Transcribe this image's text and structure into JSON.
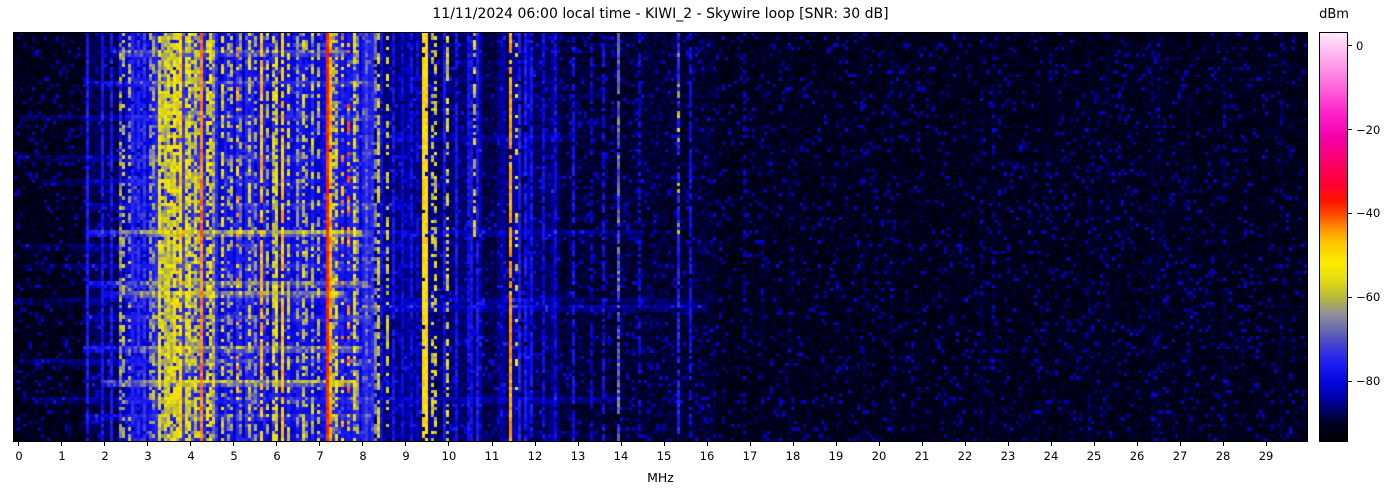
{
  "chart_data": {
    "type": "heatmap",
    "title": "11/11/2024 06:00 local time - KIWI_2 - Skywire loop [SNR: 30 dB]",
    "xlabel": "MHz",
    "colorbar_label": "dBm",
    "x_range_mhz": [
      -0.116,
      29.953
    ],
    "x_ticks_mhz": [
      0,
      1,
      2,
      3,
      4,
      5,
      6,
      7,
      8,
      9,
      10,
      11,
      12,
      13,
      14,
      15,
      16,
      17,
      18,
      19,
      20,
      21,
      22,
      23,
      24,
      25,
      26,
      27,
      28,
      29
    ],
    "colorbar_ticks_dbm": [
      0,
      -20,
      -40,
      -60,
      -80
    ],
    "colorbar_tick_labels": [
      "0",
      "−20",
      "−40",
      "−60",
      "−80"
    ],
    "value_range_dbm": [
      -94.2,
      3.0
    ],
    "grid": false,
    "legend": "none",
    "freq_bins": 431,
    "time_rows": 120,
    "colormap_stops_dbm_hex": [
      [
        -94.5,
        "#000000"
      ],
      [
        -90,
        "#000022"
      ],
      [
        -87,
        "#000068"
      ],
      [
        -84,
        "#0000aa"
      ],
      [
        -80,
        "#0707e0"
      ],
      [
        -76,
        "#1c1cf4"
      ],
      [
        -72,
        "#3c3cd8"
      ],
      [
        -68,
        "#6767b2"
      ],
      [
        -64,
        "#91919b"
      ],
      [
        -60,
        "#b8b83c"
      ],
      [
        -56,
        "#e2dc12"
      ],
      [
        -52,
        "#fcec00"
      ],
      [
        -47,
        "#ffc800"
      ],
      [
        -43,
        "#ff8800"
      ],
      [
        -40,
        "#ff4400"
      ],
      [
        -37,
        "#ff1500"
      ],
      [
        -33,
        "#ff0033"
      ],
      [
        -28,
        "#fb0068"
      ],
      [
        -22,
        "#f700aa"
      ],
      [
        -16,
        "#ff22cc"
      ],
      [
        -10,
        "#ff66dd"
      ],
      [
        -4,
        "#ffa2ea"
      ],
      [
        1,
        "#ffd7f7"
      ],
      [
        3,
        "#ffeafc"
      ]
    ],
    "background_floor_dbm": [
      [
        -0.2,
        1.55,
        -91.5
      ],
      [
        1.55,
        2.3,
        -88.5
      ],
      [
        2.3,
        3.05,
        -83.5
      ],
      [
        3.05,
        4.55,
        -77.5
      ],
      [
        4.55,
        6.5,
        -80.0
      ],
      [
        6.5,
        8.25,
        -79.0
      ],
      [
        8.25,
        9.35,
        -86.5
      ],
      [
        9.35,
        10.75,
        -87.5
      ],
      [
        10.75,
        11.35,
        -89.0
      ],
      [
        11.35,
        12.6,
        -88.0
      ],
      [
        12.6,
        16.2,
        -90.0
      ],
      [
        16.2,
        30.1,
        -91.5
      ]
    ],
    "band_format": [
      "freq_mhz",
      "width_mhz",
      "level_dbm",
      "duty",
      "jitter_db",
      "row_start_frac",
      "row_end_frac"
    ],
    "signal_bands": [
      [
        1.57,
        0.06,
        -77,
        0.95,
        3,
        0,
        1
      ],
      [
        1.93,
        0.06,
        -78,
        0.95,
        3,
        0,
        1
      ],
      [
        2.12,
        0.06,
        -77,
        0.95,
        3,
        0,
        1
      ],
      [
        2.33,
        0.05,
        -62,
        0.5,
        5,
        0,
        1
      ],
      [
        2.44,
        0.05,
        -60,
        0.5,
        5,
        0,
        1
      ],
      [
        2.56,
        0.05,
        -62,
        0.45,
        5,
        0,
        1
      ],
      [
        2.65,
        0.05,
        -75,
        0.9,
        3,
        0,
        1
      ],
      [
        2.8,
        0.05,
        -74,
        0.9,
        3,
        0,
        1
      ],
      [
        2.95,
        0.05,
        -73,
        0.85,
        3,
        0,
        1
      ],
      [
        3.05,
        0.05,
        -64,
        0.5,
        5,
        0,
        1
      ],
      [
        3.15,
        0.05,
        -62,
        0.5,
        5,
        0,
        1
      ],
      [
        3.28,
        0.08,
        -55,
        0.85,
        4,
        0,
        1
      ],
      [
        3.3,
        0.2,
        -62,
        0.4,
        6,
        0,
        1
      ],
      [
        3.38,
        0.05,
        -58,
        0.6,
        5,
        0,
        1
      ],
      [
        3.45,
        0.3,
        -60,
        0.45,
        6,
        0,
        1
      ],
      [
        3.47,
        0.05,
        -56,
        0.7,
        5,
        0,
        1
      ],
      [
        3.55,
        0.05,
        -59,
        0.5,
        5,
        0,
        1
      ],
      [
        3.63,
        0.1,
        -54,
        0.8,
        5,
        0,
        1
      ],
      [
        3.72,
        0.05,
        -57,
        0.6,
        5,
        0,
        1
      ],
      [
        3.79,
        0.05,
        -49,
        0.85,
        4,
        0,
        1
      ],
      [
        3.87,
        0.05,
        -56,
        0.6,
        5,
        0,
        1
      ],
      [
        3.93,
        0.05,
        -60,
        0.5,
        5,
        0,
        1
      ],
      [
        3.98,
        0.05,
        -55,
        0.7,
        5,
        0,
        1
      ],
      [
        4.0,
        0.25,
        -61,
        0.4,
        6,
        0,
        1
      ],
      [
        4.07,
        0.05,
        -57,
        0.55,
        5,
        0,
        1
      ],
      [
        4.15,
        0.05,
        -61,
        0.5,
        5,
        0,
        1
      ],
      [
        4.26,
        0.06,
        -43,
        1.0,
        3,
        0,
        1
      ],
      [
        4.35,
        0.05,
        -56,
        0.6,
        5,
        0,
        1
      ],
      [
        4.44,
        0.05,
        -55,
        0.65,
        5,
        0,
        1
      ],
      [
        4.52,
        0.05,
        -60,
        0.5,
        5,
        0,
        1
      ],
      [
        4.62,
        0.05,
        -74,
        0.9,
        3,
        0,
        1
      ],
      [
        4.72,
        0.05,
        -57,
        0.55,
        5,
        0,
        1
      ],
      [
        4.85,
        0.05,
        -63,
        0.45,
        5,
        0,
        1
      ],
      [
        4.95,
        0.05,
        -61,
        0.5,
        5,
        0,
        1
      ],
      [
        5.06,
        0.05,
        -48,
        0.3,
        6,
        0,
        1
      ],
      [
        5.18,
        0.05,
        -64,
        0.45,
        5,
        0,
        1
      ],
      [
        5.35,
        0.05,
        -58,
        0.6,
        5,
        0,
        1
      ],
      [
        5.5,
        0.05,
        -63,
        0.5,
        5,
        0,
        1
      ],
      [
        5.67,
        0.05,
        -47,
        0.85,
        4,
        0,
        1
      ],
      [
        5.8,
        0.05,
        -60,
        0.5,
        5,
        0,
        1
      ],
      [
        5.9,
        0.05,
        -57,
        0.6,
        5,
        0,
        1
      ],
      [
        6.0,
        0.05,
        -56,
        0.7,
        5,
        0,
        1
      ],
      [
        6.14,
        0.05,
        -48,
        0.9,
        4,
        0,
        1
      ],
      [
        6.28,
        0.05,
        -58,
        0.5,
        5,
        0,
        1
      ],
      [
        6.45,
        0.05,
        -64,
        0.5,
        5,
        0,
        1
      ],
      [
        6.6,
        0.05,
        -58,
        0.55,
        5,
        0,
        1
      ],
      [
        6.72,
        0.05,
        -62,
        0.5,
        5,
        0,
        1
      ],
      [
        6.85,
        0.05,
        -59,
        0.5,
        5,
        0,
        1
      ],
      [
        7.0,
        0.05,
        -60,
        0.5,
        5,
        0,
        1
      ],
      [
        7.16,
        0.05,
        -38,
        1.0,
        2,
        0,
        1
      ],
      [
        7.23,
        0.05,
        -46,
        0.9,
        4,
        0,
        1
      ],
      [
        7.26,
        0.22,
        -60,
        0.5,
        6,
        0,
        1
      ],
      [
        7.4,
        0.05,
        -57,
        0.6,
        5,
        0,
        1
      ],
      [
        7.53,
        0.05,
        -47,
        0.3,
        6,
        0,
        1
      ],
      [
        7.63,
        0.05,
        -44,
        0.3,
        5,
        0,
        1
      ],
      [
        7.77,
        0.05,
        -56,
        0.6,
        5,
        0,
        1
      ],
      [
        7.9,
        0.05,
        -63,
        0.5,
        5,
        0,
        1
      ],
      [
        8.05,
        0.05,
        -70,
        0.6,
        4,
        0,
        1
      ],
      [
        8.12,
        0.05,
        -79,
        0.8,
        3,
        0,
        1
      ],
      [
        8.3,
        0.05,
        -66,
        0.6,
        3,
        0,
        1
      ],
      [
        8.36,
        0.05,
        -58,
        0.6,
        4,
        0,
        1
      ],
      [
        8.45,
        0.05,
        -79,
        0.9,
        3,
        0,
        1
      ],
      [
        8.56,
        0.05,
        -57,
        0.55,
        4,
        0,
        1
      ],
      [
        8.72,
        0.05,
        -78,
        0.9,
        3,
        0,
        1
      ],
      [
        8.95,
        0.05,
        -80,
        0.9,
        3,
        0,
        1
      ],
      [
        9.12,
        0.05,
        -79,
        0.9,
        3,
        0,
        1
      ],
      [
        9.28,
        0.05,
        -80,
        0.85,
        3,
        0,
        1
      ],
      [
        9.45,
        0.09,
        -50,
        0.95,
        4,
        0,
        1
      ],
      [
        9.63,
        0.05,
        -58,
        0.45,
        5,
        0,
        1
      ],
      [
        9.72,
        0.05,
        -57,
        0.5,
        5,
        0,
        1
      ],
      [
        9.91,
        0.05,
        -77,
        0.9,
        3,
        0,
        1
      ],
      [
        9.95,
        0.05,
        -57,
        0.5,
        5,
        0,
        1
      ],
      [
        10.14,
        0.05,
        -78,
        0.9,
        3,
        0,
        1
      ],
      [
        10.49,
        0.12,
        -78,
        0.95,
        3,
        0,
        1
      ],
      [
        10.62,
        0.05,
        -58,
        0.55,
        5,
        0,
        0.5
      ],
      [
        10.65,
        0.05,
        -77,
        0.9,
        3,
        0,
        1
      ],
      [
        11.44,
        0.05,
        -45,
        0.95,
        3,
        0,
        1
      ],
      [
        11.54,
        0.05,
        -57,
        0.3,
        5,
        0,
        1
      ],
      [
        11.65,
        0.05,
        -76,
        0.9,
        3,
        0,
        1
      ],
      [
        11.81,
        0.05,
        -77,
        0.9,
        3,
        0,
        1
      ],
      [
        11.95,
        0.05,
        -78,
        0.85,
        3,
        0,
        1
      ],
      [
        12.23,
        0.05,
        -79,
        0.8,
        3,
        0,
        1
      ],
      [
        12.51,
        0.05,
        -80,
        0.8,
        3,
        0,
        1
      ],
      [
        12.9,
        0.05,
        -78,
        0.7,
        3,
        0,
        1
      ],
      [
        13.3,
        0.05,
        -81,
        0.6,
        3,
        0,
        1
      ],
      [
        13.58,
        0.05,
        -79,
        0.6,
        3,
        0,
        1
      ],
      [
        13.93,
        0.05,
        -71,
        0.9,
        4,
        0,
        1
      ],
      [
        13.93,
        0.05,
        -66,
        0.3,
        3,
        0,
        1
      ],
      [
        14.45,
        0.05,
        -80,
        0.6,
        3,
        0,
        1
      ],
      [
        15.37,
        0.05,
        -76,
        0.8,
        3,
        0,
        1
      ],
      [
        15.37,
        0.05,
        -60,
        0.2,
        5,
        0,
        0.5
      ],
      [
        15.61,
        0.05,
        -79,
        0.7,
        3,
        0,
        1
      ],
      [
        16.9,
        0.05,
        -83,
        0.4,
        3,
        0,
        1
      ]
    ],
    "streak_format": [
      "row_frac",
      "fmin_mhz",
      "fmax_mhz",
      "boost_db"
    ],
    "time_streaks": [
      [
        0.04,
        2.2,
        7.6,
        9
      ],
      [
        0.12,
        1.5,
        8.2,
        5
      ],
      [
        0.2,
        0.0,
        8.2,
        4
      ],
      [
        0.25,
        8.0,
        13.0,
        3
      ],
      [
        0.3,
        0.0,
        8.2,
        3.5
      ],
      [
        0.36,
        0.5,
        7.0,
        3
      ],
      [
        0.42,
        1.5,
        9.0,
        4
      ],
      [
        0.485,
        1.6,
        8.0,
        15
      ],
      [
        0.485,
        8.0,
        14.5,
        4
      ],
      [
        0.52,
        0.0,
        9.0,
        3.5
      ],
      [
        0.57,
        0.0,
        8.2,
        3
      ],
      [
        0.61,
        1.6,
        8.1,
        11
      ],
      [
        0.635,
        2.0,
        7.6,
        13
      ],
      [
        0.655,
        0.0,
        16.0,
        3
      ],
      [
        0.675,
        8.0,
        16.0,
        5
      ],
      [
        0.7,
        1.5,
        8.2,
        5
      ],
      [
        0.775,
        1.5,
        8.0,
        12
      ],
      [
        0.81,
        0.0,
        8.2,
        4
      ],
      [
        0.855,
        1.9,
        7.8,
        16
      ],
      [
        0.9,
        0.0,
        14.0,
        4
      ],
      [
        0.945,
        1.5,
        8.2,
        6
      ]
    ],
    "noise": {
      "cell_jitter_db": 4,
      "spike_prob": 0.1,
      "spike_db": 6,
      "stripe_region_mhz": [
        2.3,
        8.25
      ],
      "stripe_offset_db": [
        -3.5,
        5.0
      ],
      "stripe_extra_prob": 0.12,
      "stripe_extra_db": 4.5,
      "faint_line_region_mhz": [
        8.25,
        12.6
      ],
      "faint_line_prob": 0.15,
      "faint_line_db": 3
    }
  }
}
